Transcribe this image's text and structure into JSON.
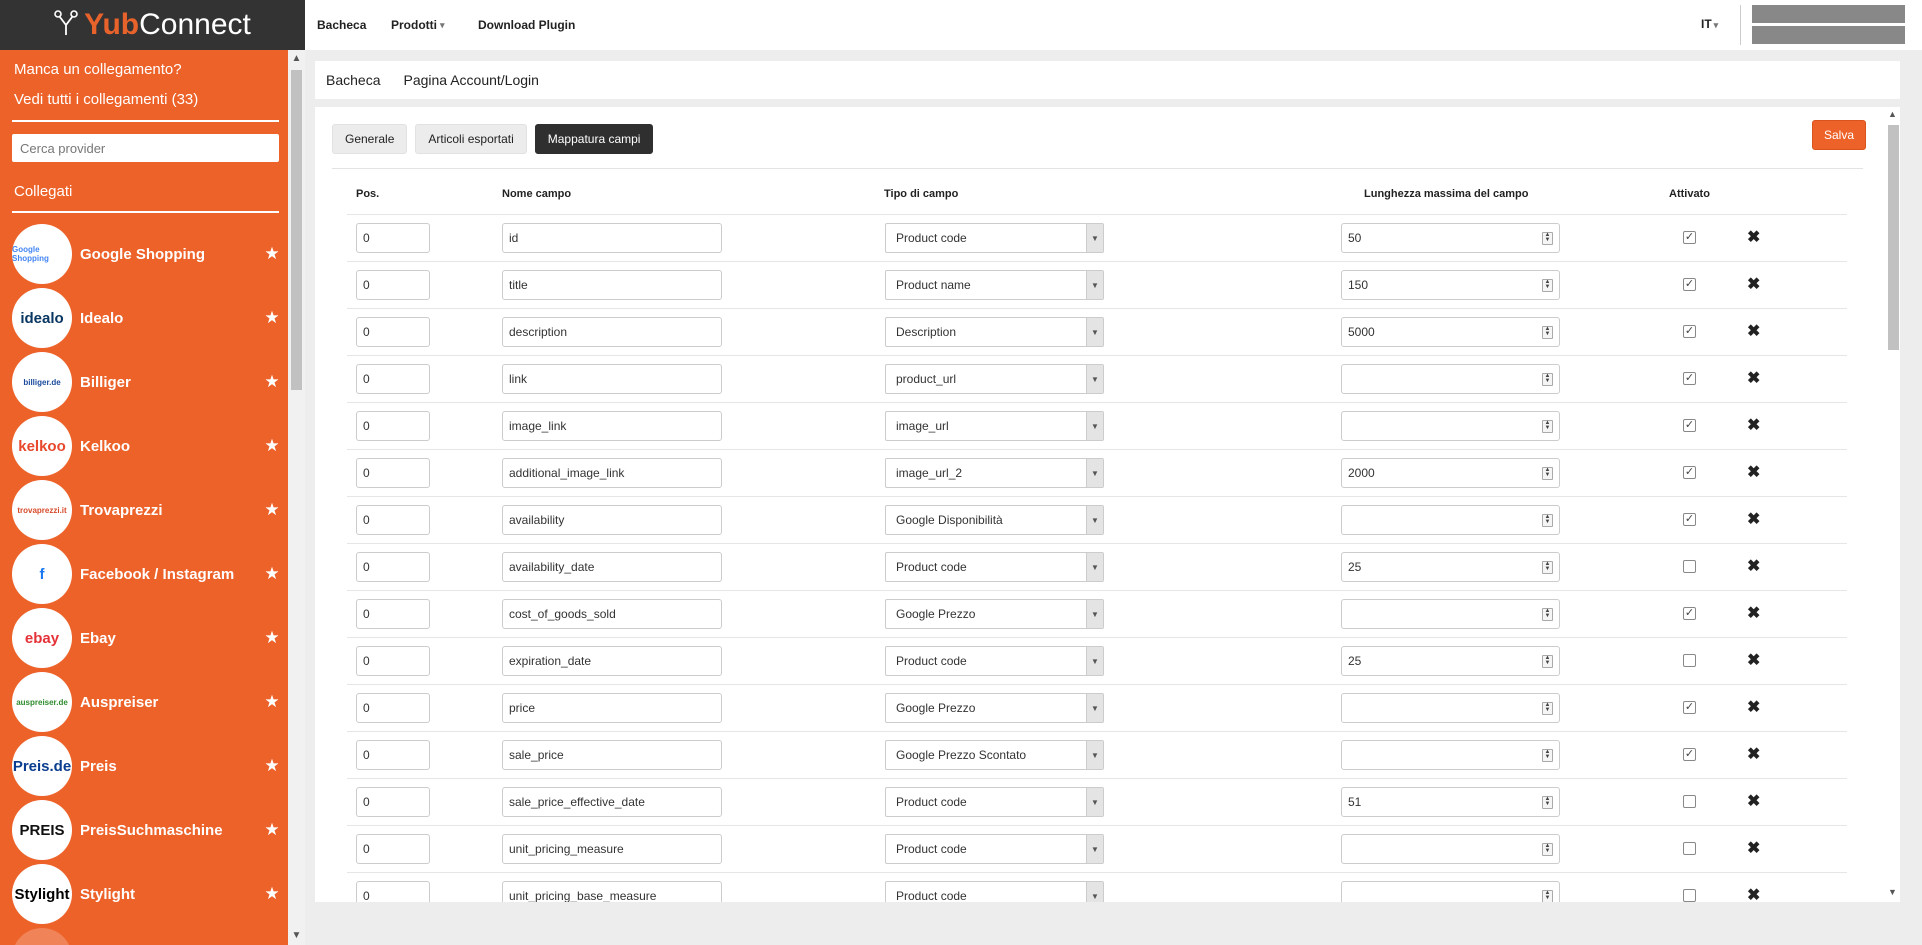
{
  "app": {
    "brand_yub": "Yub",
    "brand_connect": "Connect"
  },
  "topnav": {
    "items": [
      "Bacheca",
      "Prodotti",
      "Download Plugin"
    ],
    "lang": "IT"
  },
  "sidebar": {
    "missing_link": "Manca un collegamento?",
    "see_all": "Vedi tutti i collegamenti (33)",
    "search_placeholder": "Cerca provider",
    "connected_title": "Collegati",
    "providers": [
      {
        "name": "Google Shopping",
        "logo": "Google Shopping",
        "logo_color": "#4285f4"
      },
      {
        "name": "Idealo",
        "logo": "idealo",
        "logo_color": "#0a3761"
      },
      {
        "name": "Billiger",
        "logo": "billiger.de",
        "logo_color": "#1a4a9c"
      },
      {
        "name": "Kelkoo",
        "logo": "kelkoo",
        "logo_color": "#e8482c"
      },
      {
        "name": "Trovaprezzi",
        "logo": "trovaprezzi.it",
        "logo_color": "#d64a2a"
      },
      {
        "name": "Facebook / Instagram",
        "logo": "f",
        "logo_color": "#1877f2"
      },
      {
        "name": "Ebay",
        "logo": "ebay",
        "logo_color": "#e53238"
      },
      {
        "name": "Auspreiser",
        "logo": "auspreiser.de",
        "logo_color": "#2e8b2e"
      },
      {
        "name": "Preis",
        "logo": "Preis.de",
        "logo_color": "#0a3d8f"
      },
      {
        "name": "PreisSuchmaschine",
        "logo": "PREIS",
        "logo_color": "#111111"
      },
      {
        "name": "Stylight",
        "logo": "Stylight",
        "logo_color": "#000000"
      }
    ]
  },
  "breadcrumb": [
    "Bacheca",
    "Pagina Account/Login"
  ],
  "tabs": [
    {
      "label": "Generale",
      "active": false
    },
    {
      "label": "Articoli esportati",
      "active": false
    },
    {
      "label": "Mappatura campi",
      "active": true
    }
  ],
  "save_label": "Salva",
  "table": {
    "headers": {
      "pos": "Pos.",
      "name": "Nome campo",
      "type": "Tipo di campo",
      "maxlen": "Lunghezza massima del campo",
      "active": "Attivato"
    },
    "rows": [
      {
        "pos": "0",
        "name": "id",
        "type": "Product code",
        "maxlen": "50",
        "active": true
      },
      {
        "pos": "0",
        "name": "title",
        "type": "Product name",
        "maxlen": "150",
        "active": true
      },
      {
        "pos": "0",
        "name": "description",
        "type": "Description",
        "maxlen": "5000",
        "active": true
      },
      {
        "pos": "0",
        "name": "link",
        "type": "product_url",
        "maxlen": "",
        "active": true
      },
      {
        "pos": "0",
        "name": "image_link",
        "type": "image_url",
        "maxlen": "",
        "active": true
      },
      {
        "pos": "0",
        "name": "additional_image_link",
        "type": "image_url_2",
        "maxlen": "2000",
        "active": true
      },
      {
        "pos": "0",
        "name": "availability",
        "type": "Google Disponibilità",
        "maxlen": "",
        "active": true
      },
      {
        "pos": "0",
        "name": "availability_date",
        "type": "Product code",
        "maxlen": "25",
        "active": false
      },
      {
        "pos": "0",
        "name": "cost_of_goods_sold",
        "type": "Google Prezzo",
        "maxlen": "",
        "active": true
      },
      {
        "pos": "0",
        "name": "expiration_date",
        "type": "Product code",
        "maxlen": "25",
        "active": false
      },
      {
        "pos": "0",
        "name": "price",
        "type": "Google Prezzo",
        "maxlen": "",
        "active": true
      },
      {
        "pos": "0",
        "name": "sale_price",
        "type": "Google Prezzo Scontato",
        "maxlen": "",
        "active": true
      },
      {
        "pos": "0",
        "name": "sale_price_effective_date",
        "type": "Product code",
        "maxlen": "51",
        "active": false
      },
      {
        "pos": "0",
        "name": "unit_pricing_measure",
        "type": "Product code",
        "maxlen": "",
        "active": false
      },
      {
        "pos": "0",
        "name": "unit_pricing_base_measure",
        "type": "Product code",
        "maxlen": "",
        "active": false
      }
    ]
  },
  "colors": {
    "accent": "#ed6229",
    "dark": "#2f2f2f"
  }
}
